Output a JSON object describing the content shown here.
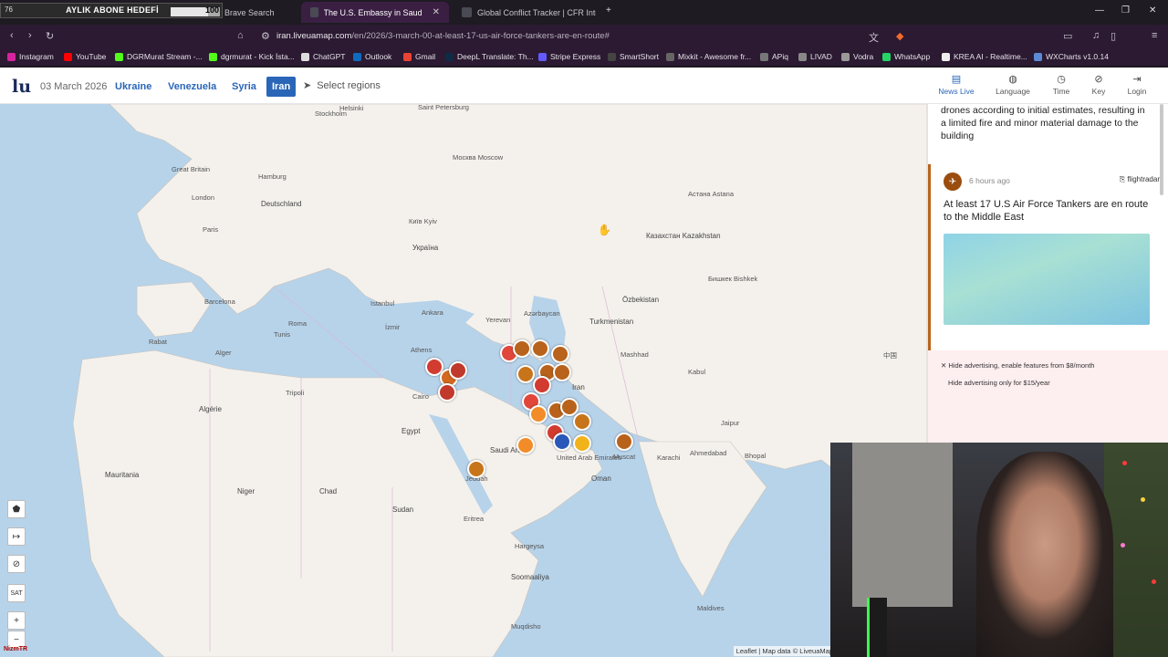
{
  "overlay": {
    "count": "76",
    "label": "AYLIK ABONE HEDEFİ",
    "value": "100",
    "progress": 0.76
  },
  "tabs": [
    {
      "label": "Brave Search",
      "active": false
    },
    {
      "label": "The U.S. Embassy in Saudi Arabia",
      "active": true
    },
    {
      "label": "Global Conflict Tracker | CFR Interactive",
      "active": false
    }
  ],
  "url": {
    "host": "iran.liveuamap.com",
    "path": "/en/2026/3-march-00-at-least-17-us-air-force-tankers-are-en-route#"
  },
  "bookmarks": [
    "Instagram",
    "YouTube",
    "DGRMurat Stream -...",
    "dgrmurat - Kick İsta...",
    "ChatGPT",
    "Outlook",
    "Gmail",
    "DeepL Translate: Th...",
    "Stripe Express",
    "SmartShort",
    "Mixkit - Awesome fr...",
    "APiq",
    "LIVAD",
    "Vodra",
    "WhatsApp",
    "KREA AI - Realtime...",
    "WXCharts v1.0.14"
  ],
  "site": {
    "date": "03 March 2026",
    "regions": [
      "Ukraine",
      "Venezuela",
      "Syria",
      "Iran"
    ],
    "active_region": "Iran",
    "select_regions": "Select regions",
    "nav": [
      {
        "label": "News Live",
        "icon": "news-icon"
      },
      {
        "label": "Language",
        "icon": "globe-icon"
      },
      {
        "label": "Time",
        "icon": "clock-icon"
      },
      {
        "label": "Key",
        "icon": "compass-icon"
      },
      {
        "label": "Login",
        "icon": "login-icon"
      }
    ]
  },
  "map": {
    "labels": [
      "Saint Petersburg",
      "Helsinki",
      "Stockholm",
      "Москва Moscow",
      "Great Britain",
      "Hamburg",
      "London",
      "Deutschland",
      "Paris",
      "Київ Kyiv",
      "Україна",
      "Казахстан Kazakhstan",
      "Астана Astana",
      "Barcelona",
      "Roma",
      "Istanbul",
      "Ankara",
      "İzmir",
      "Athens",
      "Yerevan",
      "Azərbaycan",
      "Turkmenistan",
      "Özbekistan",
      "Бишкек Bishkek",
      "Mashhad",
      "Kabul",
      "Iran",
      "Rabat",
      "Alger",
      "Algérie",
      "Tunis",
      "Tripoli",
      "Cairo",
      "Egypt",
      "Saudi Arabia",
      "United Arab Emirates",
      "Muscat",
      "Oman",
      "Karachi",
      "Jaipur",
      "Ahmedabad",
      "Bhopal",
      "Jeddah",
      "Mauritania",
      "Niger",
      "Chad",
      "Sudan",
      "Eritrea",
      "Hargeysa",
      "Soomaaliya",
      "Muqdisho",
      "Maldives",
      "中国"
    ],
    "attribution": "Leaflet | Map data © LiveuaMap"
  },
  "feed": {
    "previous_text": "drones according to initial estimates, resulting in a limited fire and minor material damage to the building",
    "card": {
      "time": "6 hours ago",
      "source": "flightradar",
      "title": "At least 17 U.S Air Force Tankers are en route to the Middle East"
    },
    "ads": {
      "line1": "Hide advertising, enable features from $8/month",
      "line2": "Hide advertising only for $15/year"
    }
  },
  "map_controls": {
    "sat": "SAT",
    "zoom_in": "+",
    "zoom_out": "−"
  },
  "watermark": "NizmTR"
}
